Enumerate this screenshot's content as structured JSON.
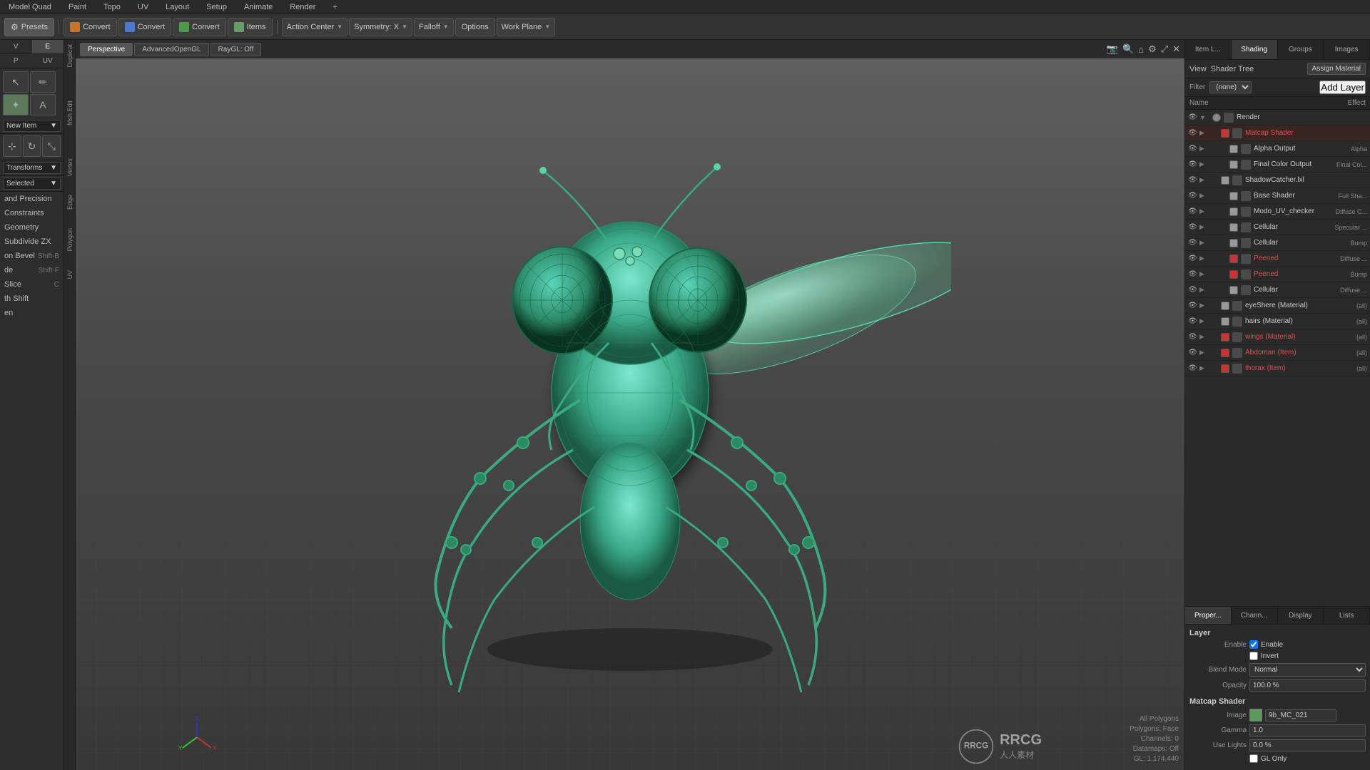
{
  "menu": {
    "items": [
      "Model Quad",
      "Paint",
      "Topo",
      "UV",
      "Layout",
      "Setup",
      "Animate",
      "Render",
      "+"
    ]
  },
  "toolbar": {
    "presets_label": "Presets",
    "convert_btns": [
      "Convert",
      "Convert",
      "Convert"
    ],
    "items_label": "Items",
    "action_center_label": "Action Center",
    "symmetry_label": "Symmetry: X",
    "falloff_label": "Falloff",
    "options_label": "Options",
    "work_plane_label": "Work Plane"
  },
  "viewport": {
    "tabs": [
      "Perspective",
      "AdvancedOpenGL",
      "RayGL: Off"
    ],
    "active_tab": "Perspective",
    "corner_info": {
      "mode": "All Polygons",
      "polygons": "Polygons: Face",
      "channels": "Channels: 0",
      "datamaps": "Datamaps: Off",
      "gl_coords": "GL: 1,174,440"
    }
  },
  "left_panel": {
    "top_tabs": [
      "Vert",
      "Edge",
      "Poly",
      "UVs"
    ],
    "active_tab": "Poly",
    "sections": {
      "new_item": "New Item",
      "transforms": "Transforms",
      "selected": "Selected",
      "and_precision": "and Precision",
      "constraints": "Constraints",
      "geometry": "Geometry",
      "subdivide_zx": "Subdivide ZX",
      "on_bevel": "on Bevel",
      "de": "de",
      "slice": "Slice",
      "th_shift": "th Shift",
      "en": "en"
    },
    "menu_items": [
      {
        "label": "Slice",
        "shortcut": "C"
      },
      {
        "label": "th Shift",
        "shortcut": ""
      },
      {
        "label": "en",
        "shortcut": ""
      }
    ]
  },
  "right_panel": {
    "top_tabs": [
      "Item L...",
      "Shading",
      "Groups",
      "Images"
    ],
    "active_tab": "Shading",
    "view_label": "View",
    "shader_tree_label": "Shader Tree",
    "assign_material_label": "Assign Material",
    "filter_label": "Filter",
    "filter_value": "(none)",
    "add_layer_label": "Add Layer",
    "columns": {
      "name": "Name",
      "effect": "Effect"
    },
    "shader_items": [
      {
        "name": "Render",
        "type": "",
        "color": "#888",
        "visible": true,
        "expanded": true,
        "indent": 0
      },
      {
        "name": "Matcap Shader",
        "type": "",
        "color": "#cc3333",
        "visible": true,
        "expanded": false,
        "indent": 1,
        "selected": true
      },
      {
        "name": "Alpha Output",
        "type": "Alpha",
        "color": "#999",
        "visible": true,
        "expanded": false,
        "indent": 2
      },
      {
        "name": "Final Color Output",
        "type": "Final Col...",
        "color": "#999",
        "visible": true,
        "expanded": false,
        "indent": 2
      },
      {
        "name": "ShadowCatcher.lxl",
        "type": "",
        "color": "#999",
        "visible": true,
        "expanded": false,
        "indent": 1
      },
      {
        "name": "Base Shader",
        "type": "Full Sha...",
        "color": "#999",
        "visible": true,
        "expanded": false,
        "indent": 2
      },
      {
        "name": "Modo_UV_checker",
        "type": "Diffuse C...",
        "color": "#999",
        "visible": true,
        "expanded": false,
        "indent": 2
      },
      {
        "name": "Cellular",
        "type": "Specular ...",
        "color": "#999",
        "visible": true,
        "expanded": false,
        "indent": 2
      },
      {
        "name": "Cellular",
        "type": "Bump",
        "color": "#999",
        "visible": true,
        "expanded": false,
        "indent": 2
      },
      {
        "name": "Peened",
        "type": "Diffuse ...",
        "color": "#cc3333",
        "visible": true,
        "expanded": false,
        "indent": 2
      },
      {
        "name": "Peened",
        "type": "Bump",
        "color": "#cc3333",
        "visible": true,
        "expanded": false,
        "indent": 2
      },
      {
        "name": "Cellular",
        "type": "Diffuse ...",
        "color": "#999",
        "visible": true,
        "expanded": false,
        "indent": 2
      },
      {
        "name": "eyeShere (Material)",
        "type": "(all)",
        "color": "#999",
        "visible": true,
        "expanded": false,
        "indent": 1
      },
      {
        "name": "hairs (Material)",
        "type": "(all)",
        "color": "#999",
        "visible": true,
        "expanded": false,
        "indent": 1
      },
      {
        "name": "wings (Material)",
        "type": "(all)",
        "color": "#cc3333",
        "visible": true,
        "expanded": false,
        "indent": 1
      },
      {
        "name": "Abdoman (Item)",
        "type": "(all)",
        "color": "#cc3333",
        "visible": true,
        "expanded": false,
        "indent": 1
      },
      {
        "name": "thorax (Item)",
        "type": "(all)",
        "color": "#cc3333",
        "visible": true,
        "expanded": false,
        "indent": 1
      }
    ],
    "bottom_tabs": [
      "Proper...",
      "Chann...",
      "Display",
      "Lists"
    ],
    "active_bottom_tab": "Proper...",
    "properties": {
      "section": "Layer",
      "blend_mode_label": "Blend Mode",
      "blend_mode_value": "Normal",
      "opacity_label": "Opacity",
      "opacity_value": "100.0 %",
      "section2": "Matcap Shader",
      "image_label": "Image",
      "image_value": "9b_MC_021",
      "gamma_label": "Gamma",
      "gamma_value": "1.0",
      "use_lights_label": "Use Lights",
      "use_lights_value": "0.0 %",
      "gl_only_label": "GL Only",
      "enable_label": "Enable",
      "invert_label": "Invert"
    }
  },
  "watermark": {
    "logo_text": "RRCG",
    "sub_text": "人人素材"
  }
}
